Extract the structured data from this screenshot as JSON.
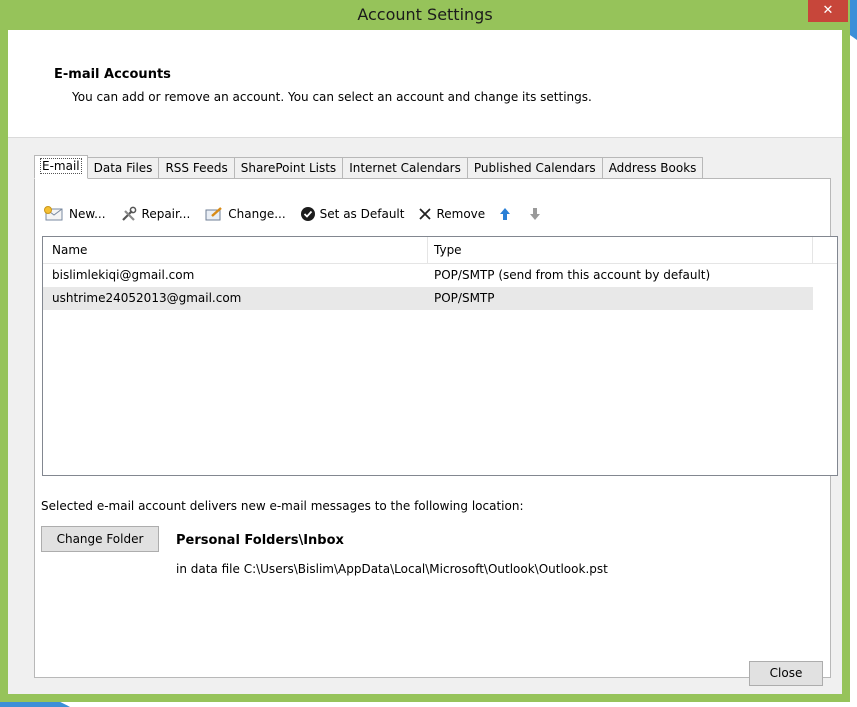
{
  "window": {
    "title": "Account Settings",
    "close_glyph": "✕"
  },
  "header": {
    "title": "E-mail Accounts",
    "description": "You can add or remove an account. You can select an account and change its settings."
  },
  "tabs": [
    {
      "label": "E-mail",
      "active": true
    },
    {
      "label": "Data Files"
    },
    {
      "label": "RSS Feeds"
    },
    {
      "label": "SharePoint Lists"
    },
    {
      "label": "Internet Calendars"
    },
    {
      "label": "Published Calendars"
    },
    {
      "label": "Address Books"
    }
  ],
  "toolbar": {
    "new_label": "New...",
    "repair_label": "Repair...",
    "change_label": "Change...",
    "set_default_label": "Set as Default",
    "remove_label": "Remove"
  },
  "accounts": {
    "columns": [
      "Name",
      "Type"
    ],
    "rows": [
      {
        "name": "bislimlekiqi@gmail.com",
        "type": "POP/SMTP (send from this account by default)"
      },
      {
        "name": "ushtrime24052013@gmail.com",
        "type": "POP/SMTP"
      }
    ]
  },
  "location": {
    "description": "Selected e-mail account delivers new e-mail messages to the following location:",
    "change_folder_label": "Change Folder",
    "folder": "Personal Folders\\Inbox",
    "data_file": "in data file C:\\Users\\Bislim\\AppData\\Local\\Microsoft\\Outlook\\Outlook.pst"
  },
  "footer": {
    "close_label": "Close"
  },
  "colors": {
    "frame": "#96c35a",
    "close_button": "#c7463a",
    "accent_arrow": "#2a7fd6"
  }
}
